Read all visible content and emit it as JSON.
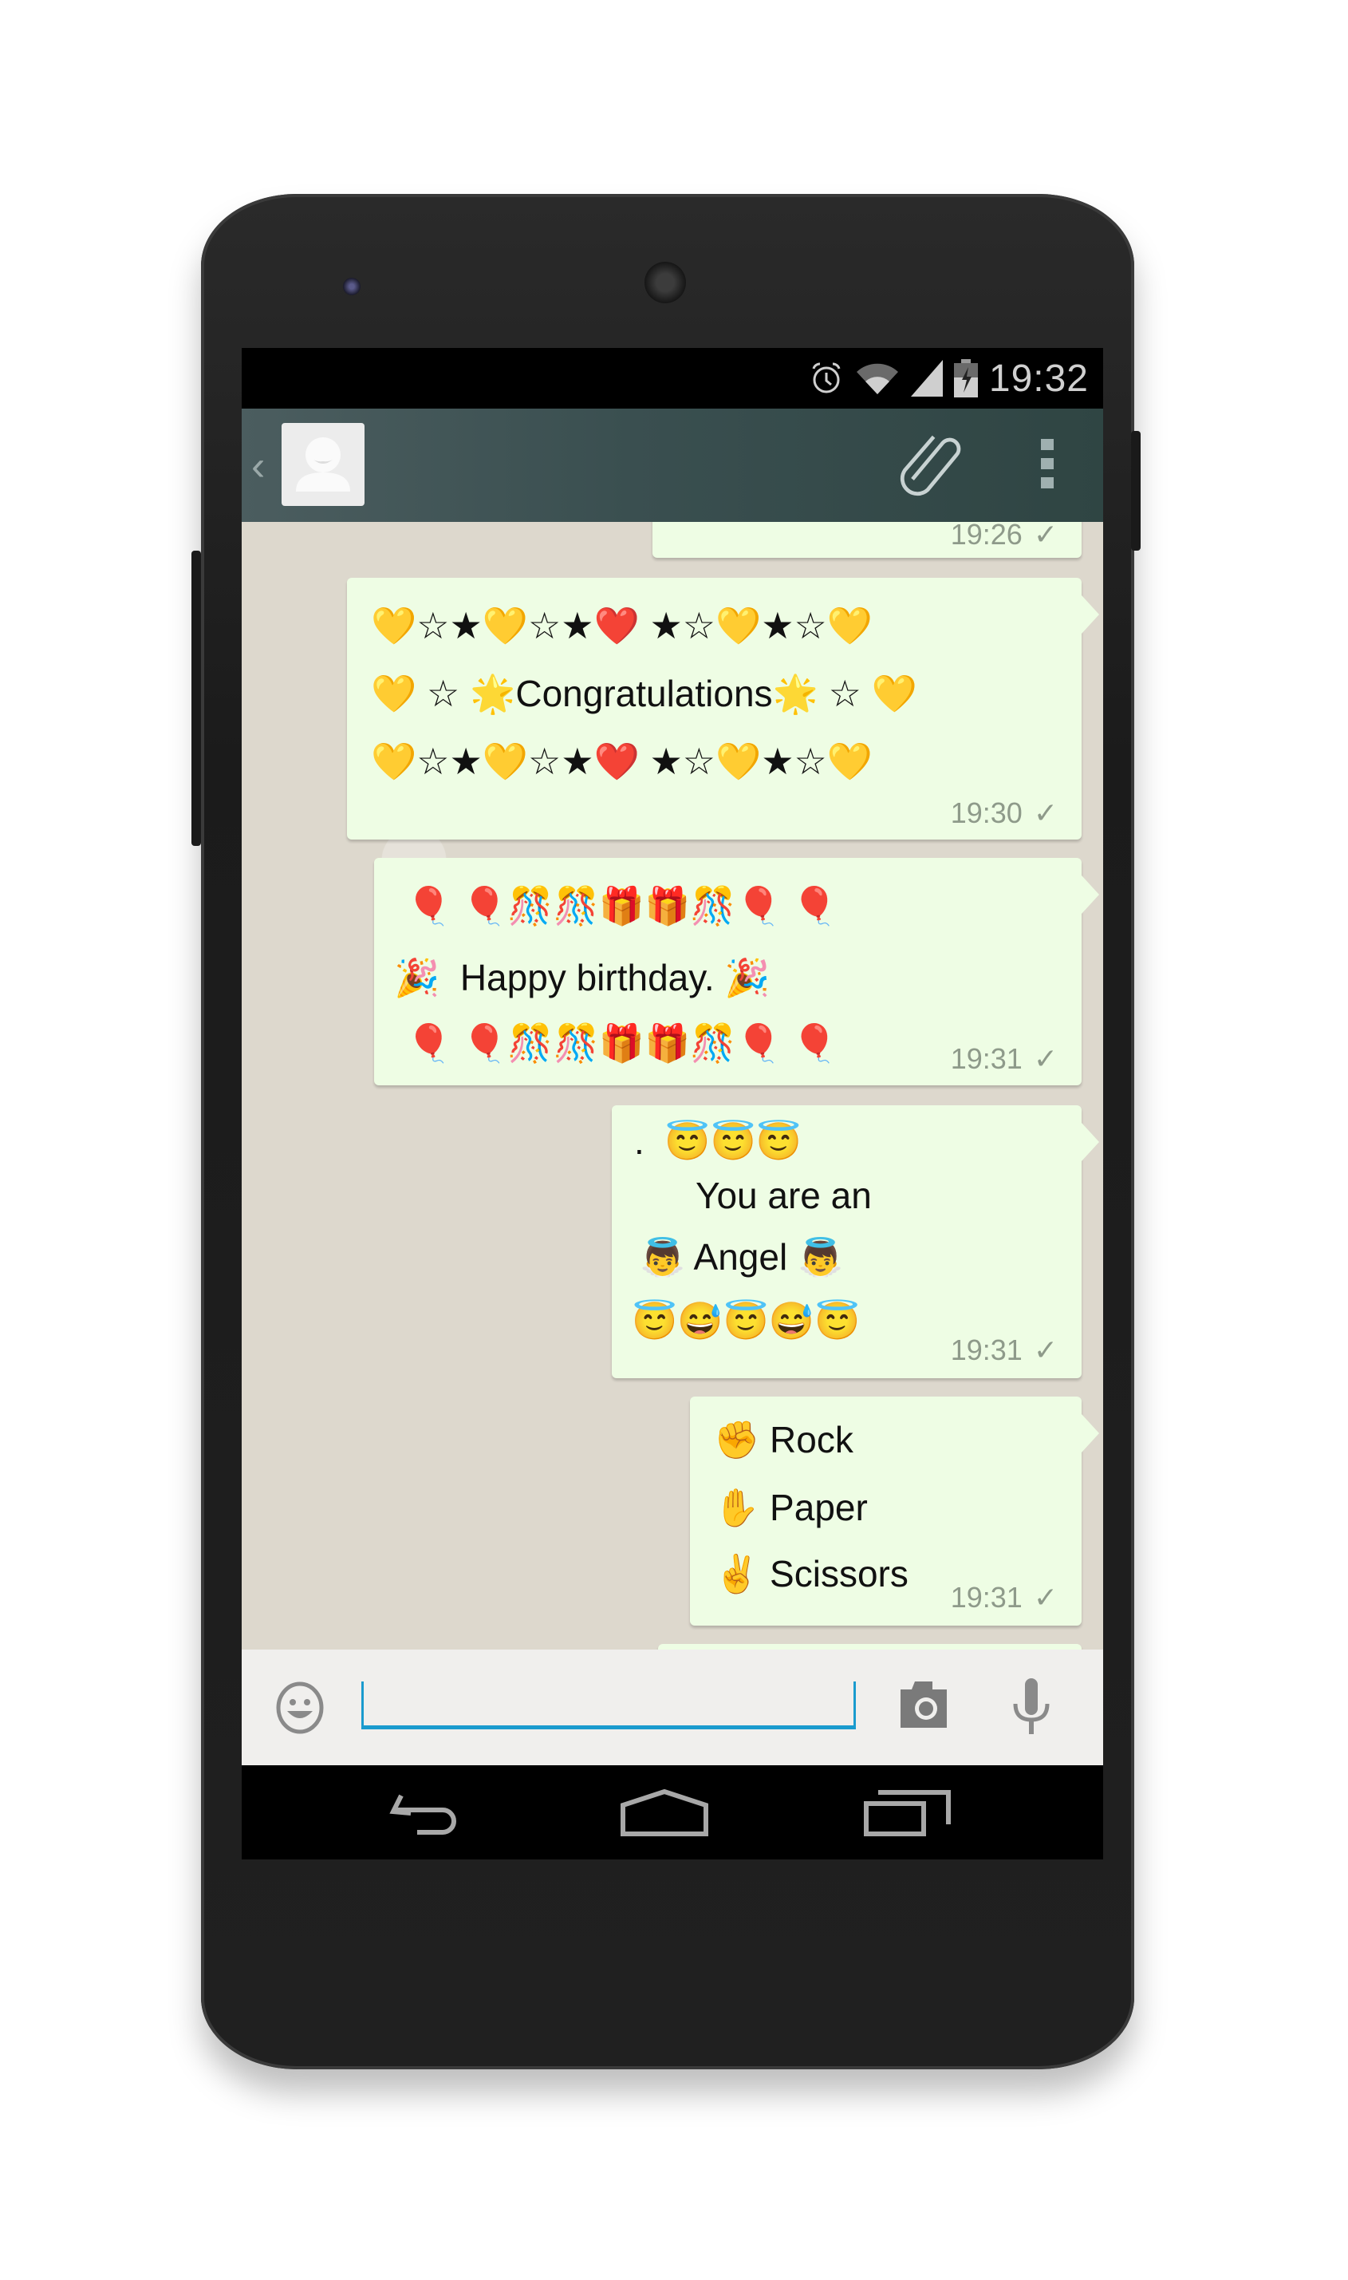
{
  "status_bar": {
    "time": "19:32",
    "icons": [
      "alarm-icon",
      "wifi-icon",
      "signal-icon",
      "battery-charging-icon"
    ]
  },
  "action_bar": {
    "back_icon": "chevron-left-icon",
    "avatar_icon": "default-contact-avatar",
    "attach_icon": "paperclip-icon",
    "menu_icon": "overflow-menu-icon"
  },
  "messages": [
    {
      "time": "19:26",
      "status": "sent-check",
      "lines": []
    },
    {
      "time": "19:30",
      "status": "sent-check",
      "lines": [
        "💛☆★💛☆★❤️ ★☆💛★☆💛",
        "💛 ☆ 🌟Congratulations🌟 ☆ 💛",
        "💛☆★💛☆★❤️ ★☆💛★☆💛"
      ]
    },
    {
      "time": "19:31",
      "status": "sent-check",
      "lines": [
        "🎈 🎈🎊🎊🎁🎁🎊🎈 🎈",
        "🎉  Happy birthday. 🎉",
        "🎈 🎈🎊🎊🎁🎁🎊🎈 🎈"
      ]
    },
    {
      "time": "19:31",
      "status": "sent-check",
      "lines": [
        ".  😇😇😇",
        "You are an",
        "👼 Angel 👼",
        "😇😅😇😅😇"
      ]
    },
    {
      "time": "19:31",
      "status": "sent-check",
      "lines": [
        "✊ Rock",
        "✋ Paper",
        "✌️ Scissors"
      ]
    }
  ],
  "input_bar": {
    "emoji_icon": "smiley-icon",
    "message_value": "",
    "camera_icon": "camera-icon",
    "mic_icon": "microphone-icon",
    "accent_color": "#1a9bce"
  },
  "nav_bar": {
    "icons": [
      "back-icon",
      "home-icon",
      "recent-apps-icon"
    ]
  },
  "colors": {
    "action_bar": "#2f4543",
    "bubble": "#eefde4",
    "chat_background": "#ddd8cd",
    "time_text": "#8e9a8a"
  }
}
